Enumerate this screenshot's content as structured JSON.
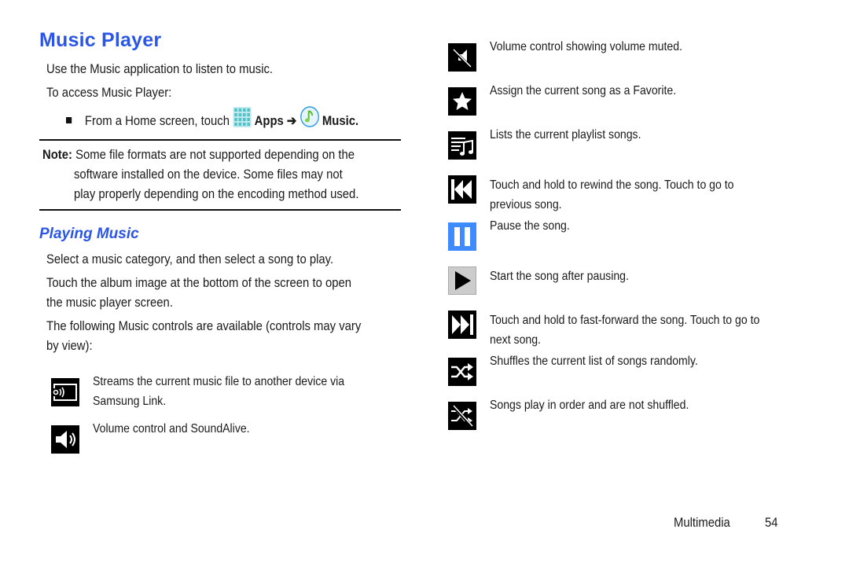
{
  "page": {
    "title": "Music Player",
    "intro": "Use the Music application to listen to music.",
    "access_label": "To access Music Player:",
    "step": {
      "prefix": "From a Home screen, touch",
      "apps_icon": "apps-grid-icon",
      "apps_label": "Apps",
      "arrow": "➔",
      "music_icon": "music-app-icon",
      "music_label": "Music",
      "suffix": "."
    },
    "note": {
      "label": "Note:",
      "line1": "Some file formats are not supported depending on the",
      "line2": "software installed on the device. Some files may not",
      "line3": "play properly depending on the encoding method used."
    },
    "section_title": "Playing Music",
    "paragraphs": [
      "Select a music category, and then select a song to play.",
      "Touch the album image at the bottom of the screen to open",
      "the music player screen.",
      "The following Music controls are available (controls may vary",
      "by view):"
    ],
    "controls_left": [
      {
        "icon": "samsung-link-icon",
        "lines": [
          "Streams the current music file to another device via",
          "Samsung Link."
        ]
      },
      {
        "icon": "volume-icon",
        "lines": [
          "Volume control and SoundAlive."
        ]
      }
    ],
    "controls_right": [
      {
        "icon": "volume-muted-icon",
        "lines": [
          "Volume control showing volume muted."
        ]
      },
      {
        "icon": "favorite-star-icon",
        "lines": [
          "Assign the current song as a Favorite."
        ]
      },
      {
        "icon": "playlist-icon",
        "lines": [
          "Lists the current playlist songs."
        ]
      },
      {
        "icon": "rewind-previous-icon",
        "lines": [
          "Touch and hold to rewind the song. Touch to go to",
          "previous song."
        ]
      },
      {
        "icon": "pause-icon",
        "lines": [
          "Pause the song."
        ]
      },
      {
        "icon": "play-icon",
        "lines": [
          "Start the song after pausing."
        ]
      },
      {
        "icon": "fast-forward-next-icon",
        "lines": [
          "Touch and hold to fast-forward the song. Touch to go to",
          "next song."
        ]
      },
      {
        "icon": "shuffle-on-icon",
        "lines": [
          "Shuffles the current list of songs randomly."
        ]
      },
      {
        "icon": "shuffle-off-icon",
        "lines": [
          "Songs play in order and are not shuffled."
        ]
      }
    ],
    "colors": {
      "heading": "#2a55e6",
      "pause_icon_bg": "#3d8bff",
      "play_icon_bg": "#cccccc",
      "apps_icon": "#4fc3c8",
      "music_icon": "#7fd14a"
    },
    "footer": {
      "section": "Multimedia",
      "page_number": "54"
    }
  }
}
